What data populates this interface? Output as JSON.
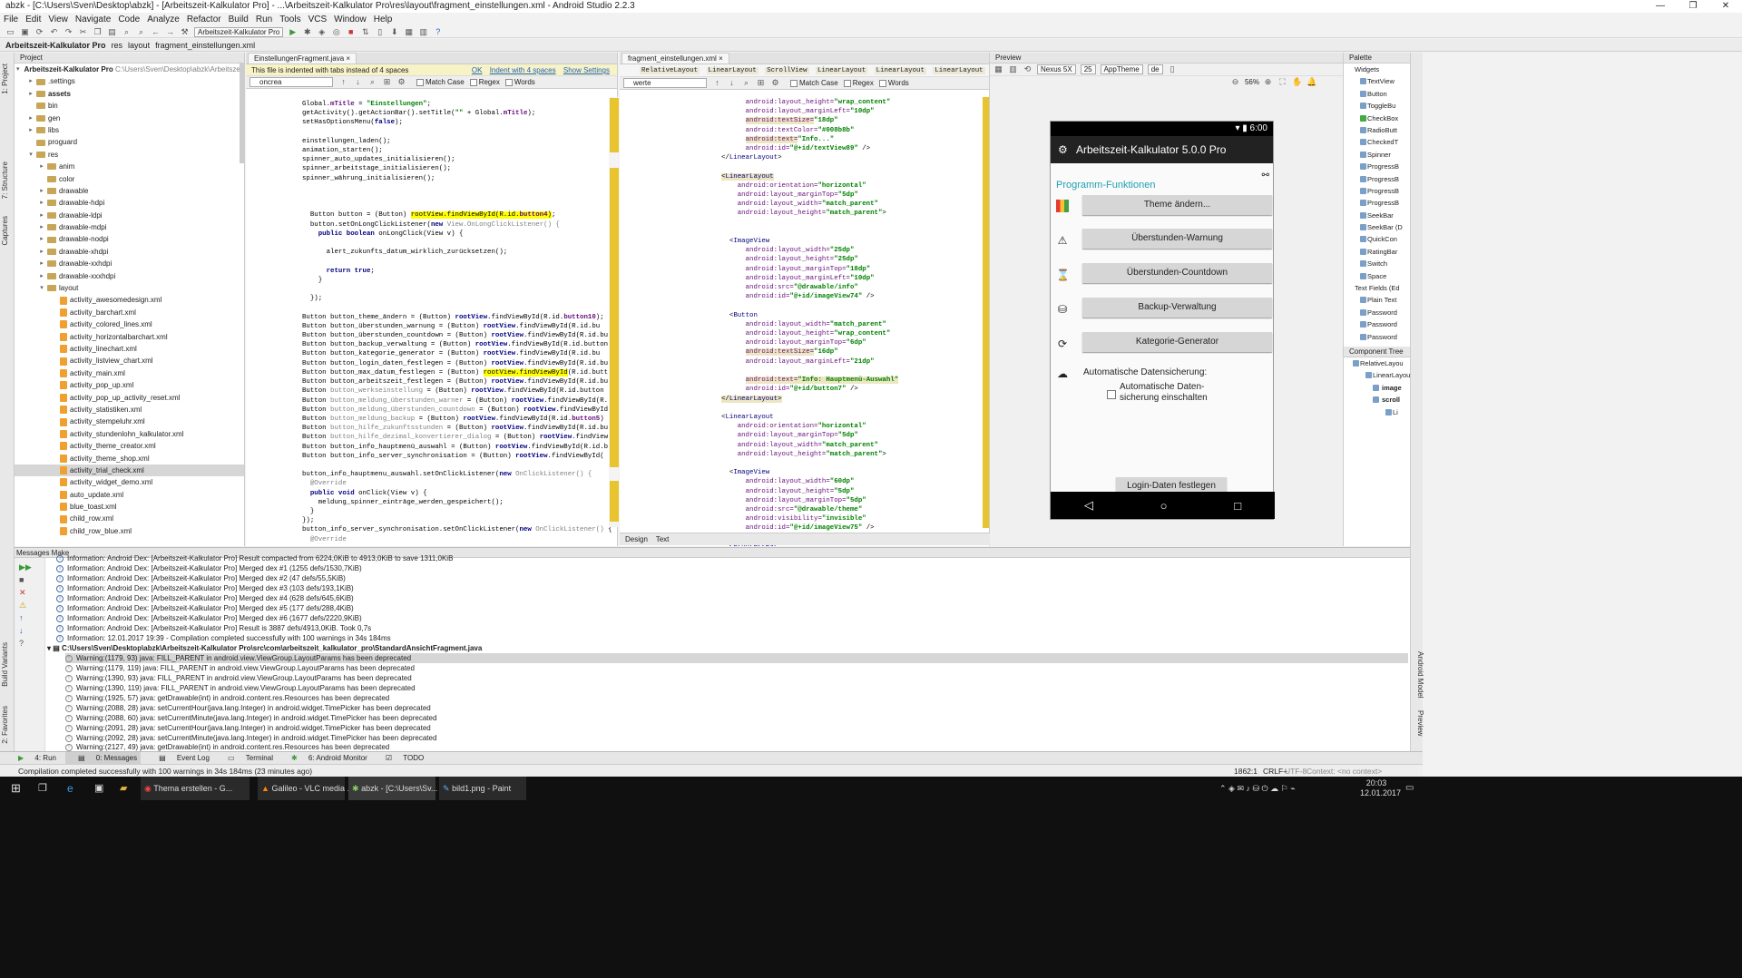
{
  "window": {
    "title": "abzk - [C:\\Users\\Sven\\Desktop\\abzk] - [Arbeitszeit-Kalkulator Pro] - ...\\Arbeitszeit-Kalkulator Pro\\res\\layout\\fragment_einstellungen.xml - Android Studio 2.2.3"
  },
  "menu": [
    "File",
    "Edit",
    "View",
    "Navigate",
    "Code",
    "Analyze",
    "Refactor",
    "Build",
    "Run",
    "Tools",
    "VCS",
    "Window",
    "Help"
  ],
  "toolbar": {
    "run_config": "Arbeitszeit-Kalkulator Pro"
  },
  "breadcrumb": [
    "Arbeitszeit-Kalkulator Pro",
    "res",
    "layout",
    "fragment_einstellungen.xml"
  ],
  "left_tabs": [
    "1: Project",
    "7: Structure",
    "Captures"
  ],
  "left_tabs_bottom": [
    "Build Variants",
    "2: Favorites"
  ],
  "right_tabs": [
    "Android Model",
    "Preview"
  ],
  "project": {
    "header": "Project",
    "root_name": "Arbeitszeit-Kalkulator Pro",
    "root_path": "C:\\Users\\Sven\\Desktop\\abzk\\Arbeitszeit-K",
    "items": [
      ".settings",
      "assets",
      "bin",
      "gen",
      "libs",
      "proguard",
      "res",
      "anim",
      "color",
      "drawable",
      "drawable-hdpi",
      "drawable-ldpi",
      "drawable-mdpi",
      "drawable-nodpi",
      "drawable-xhdpi",
      "drawable-xxhdpi",
      "drawable-xxxhdpi",
      "layout",
      "activity_awesomedesign.xml",
      "activity_barchart.xml",
      "activity_colored_lines.xml",
      "activity_horizontalbarchart.xml",
      "activity_linechart.xml",
      "activity_listview_chart.xml",
      "activity_main.xml",
      "activity_pop_up.xml",
      "activity_pop_up_activity_reset.xml",
      "activity_statistiken.xml",
      "activity_stempeluhr.xml",
      "activity_stundenlohn_kalkulator.xml",
      "activity_theme_creator.xml",
      "activity_theme_shop.xml",
      "activity_trial_check.xml",
      "activity_widget_demo.xml",
      "auto_update.xml",
      "blue_toast.xml",
      "child_row.xml",
      "child_row_blue.xml"
    ]
  },
  "editor1": {
    "tab": "EinstellungenFragment.java",
    "notice": "This file is indented with tabs instead of 4 spaces",
    "notice_ok": "OK",
    "notice_indent": "Indent with 4 spaces",
    "notice_settings": "Show Settings",
    "search": "oncrea",
    "match_case": "Match Case",
    "regex": "Regex",
    "words": "Words"
  },
  "editor2": {
    "tab": "fragment_einstellungen.xml",
    "search": "werte",
    "match_case": "Match Case",
    "regex": "Regex",
    "words": "Words",
    "crumbs": [
      "RelativeLayout",
      "LinearLayout",
      "ScrollView",
      "LinearLayout",
      "LinearLayout",
      "LinearLayout"
    ],
    "bottom_tabs": [
      "Design",
      "Text"
    ]
  },
  "preview": {
    "header": "Preview",
    "device": "Nexus 5X",
    "api": "25",
    "theme": "AppTheme",
    "locale": "de",
    "zoom": "56%",
    "time": "6:00",
    "app_title": "Arbeitszeit-Kalkulator 5.0.0 Pro",
    "section": "Programm-Funktionen",
    "buttons": [
      "Theme ändern...",
      "Überstunden-Warnung",
      "Überstunden-Countdown",
      "Backup-Verwaltung",
      "Kategorie-Generator"
    ],
    "auto_backup": "Automatische Datensicherung:",
    "checkbox": "Automatische Daten-\nsicherung einschalten",
    "login": "Login-Daten festlegen"
  },
  "palette": {
    "header": "Palette",
    "groups": [
      "Widgets",
      "Text Fields (Ed"
    ],
    "items": [
      "TextView",
      "Button",
      "ToggleBu",
      "CheckBox",
      "RadioButt",
      "CheckedT",
      "Spinner",
      "ProgressB",
      "ProgressB",
      "ProgressB",
      "ProgressB",
      "SeekBar",
      "SeekBar (D",
      "QuickCon",
      "RatingBar",
      "Switch",
      "Space"
    ],
    "text_items": [
      "Plain Text",
      "Password",
      "Password",
      "Password"
    ],
    "tree_header": "Component Tree",
    "tree": [
      "RelativeLayou",
      "LinearLayou",
      "image",
      "scroll",
      "Li"
    ]
  },
  "messages": {
    "header": "Messages Make",
    "lines": [
      "Information: Android Dex: [Arbeitszeit-Kalkulator Pro] Result compacted from 6224,0KiB to 4913,0KiB to save 1311,0KiB",
      "Information: Android Dex: [Arbeitszeit-Kalkulator Pro] Merged dex #1 (1255 defs/1530,7KiB)",
      "Information: Android Dex: [Arbeitszeit-Kalkulator Pro] Merged dex #2 (47 defs/55,5KiB)",
      "Information: Android Dex: [Arbeitszeit-Kalkulator Pro] Merged dex #3 (103 defs/193,1KiB)",
      "Information: Android Dex: [Arbeitszeit-Kalkulator Pro] Merged dex #4 (628 defs/645,6KiB)",
      "Information: Android Dex: [Arbeitszeit-Kalkulator Pro] Merged dex #5 (177 defs/288,4KiB)",
      "Information: Android Dex: [Arbeitszeit-Kalkulator Pro] Merged dex #6 (1677 defs/2220,9KiB)",
      "Information: Android Dex: [Arbeitszeit-Kalkulator Pro] Result is 3887 defs/4913,0KiB. Took 0,7s",
      "Information: 12.01.2017 19:39 - Compilation completed successfully with 100 warnings in 34s 184ms"
    ],
    "file": "C:\\Users\\Sven\\Desktop\\abzk\\Arbeitszeit-Kalkulator Pro\\src\\com\\arbeitszeit_kalkulator_pro\\StandardAnsichtFragment.java",
    "warnings": [
      "Warning:(1179, 93)  java: FILL_PARENT in android.view.ViewGroup.LayoutParams has been deprecated",
      "Warning:(1179, 119)  java: FILL_PARENT in android.view.ViewGroup.LayoutParams has been deprecated",
      "Warning:(1390, 93)  java: FILL_PARENT in android.view.ViewGroup.LayoutParams has been deprecated",
      "Warning:(1390, 119)  java: FILL_PARENT in android.view.ViewGroup.LayoutParams has been deprecated",
      "Warning:(1925, 57)  java: getDrawable(int) in android.content.res.Resources has been deprecated",
      "Warning:(2088, 28)  java: setCurrentHour(java.lang.Integer) in android.widget.TimePicker has been deprecated",
      "Warning:(2088, 60)  java: setCurrentMinute(java.lang.Integer) in android.widget.TimePicker has been deprecated",
      "Warning:(2091, 28)  java: setCurrentHour(java.lang.Integer) in android.widget.TimePicker has been deprecated",
      "Warning:(2092, 28)  java: setCurrentMinute(java.lang.Integer) in android.widget.TimePicker has been deprecated",
      "Warning:(2127, 49)  java: getDrawable(int) in android.content.res.Resources has been deprecated"
    ]
  },
  "toolwindows": [
    "4: Run",
    "0: Messages",
    "Event Log",
    "Terminal",
    "6: Android Monitor",
    "TODO"
  ],
  "status": {
    "text": "Compilation completed successfully with 100 warnings in 34s 184ms (23 minutes ago)",
    "pos": "1862:1",
    "crlf": "CRLF÷",
    "enc": "UTF-8",
    "context": "Context: <no context>"
  },
  "taskbar": {
    "items": [
      "Thema erstellen - G...",
      "Galileo - VLC media ...",
      "abzk - [C:\\Users\\Sv...",
      "bild1.png - Paint"
    ],
    "time": "20:03",
    "date": "12.01.2017"
  }
}
